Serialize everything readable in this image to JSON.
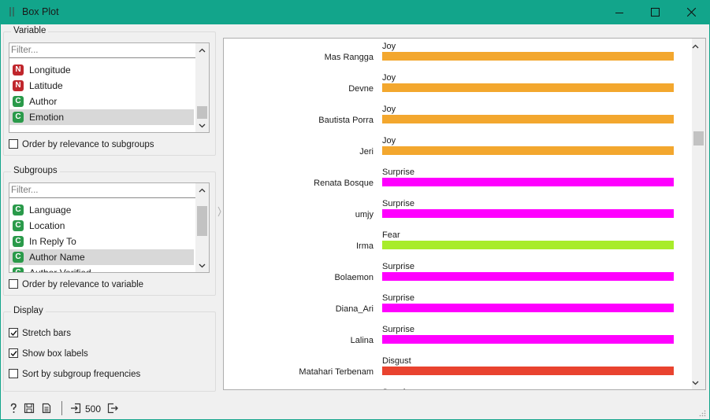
{
  "window": {
    "title": "Box Plot"
  },
  "variable": {
    "group_title": "Variable",
    "filter_placeholder": "Filter...",
    "items": [
      {
        "type": "N",
        "label": "Longitude"
      },
      {
        "type": "N",
        "label": "Latitude"
      },
      {
        "type": "C",
        "label": "Author"
      },
      {
        "type": "C",
        "label": "Emotion",
        "selected": true
      }
    ],
    "order_label": "Order by relevance to subgroups",
    "order_checked": false
  },
  "subgroups": {
    "group_title": "Subgroups",
    "filter_placeholder": "Filter...",
    "items": [
      {
        "type": "C",
        "label": "Language"
      },
      {
        "type": "C",
        "label": "Location"
      },
      {
        "type": "C",
        "label": "In Reply To"
      },
      {
        "type": "C",
        "label": "Author Name",
        "selected": true
      },
      {
        "type": "C",
        "label": "Author Verified"
      }
    ],
    "order_label": "Order by relevance to variable",
    "order_checked": false
  },
  "display": {
    "group_title": "Display",
    "stretch_label": "Stretch bars",
    "stretch_checked": true,
    "labels_label": "Show box labels",
    "labels_checked": true,
    "sort_label": "Sort by subgroup frequencies",
    "sort_checked": false
  },
  "status": {
    "count": "500"
  },
  "colors": {
    "Joy": "#f3a72e",
    "Surprise": "#ff00ff",
    "Fear": "#a8ec2a",
    "Disgust": "#e9432f"
  },
  "chart_data": {
    "type": "bar",
    "orientation": "horizontal",
    "stretched": true,
    "categories": [
      "Mas Rangga",
      "Devne",
      "Bautista Porra",
      "Jeri",
      "Renata Bosque",
      "umjy",
      "Irma",
      "Bolaemon",
      "Diana_Ari",
      "Lalina",
      "Matahari Terbenam"
    ],
    "values": [
      "Joy",
      "Joy",
      "Joy",
      "Joy",
      "Surprise",
      "Surprise",
      "Fear",
      "Surprise",
      "Surprise",
      "Surprise",
      "Disgust"
    ],
    "partial_next_label": "Surprise"
  }
}
